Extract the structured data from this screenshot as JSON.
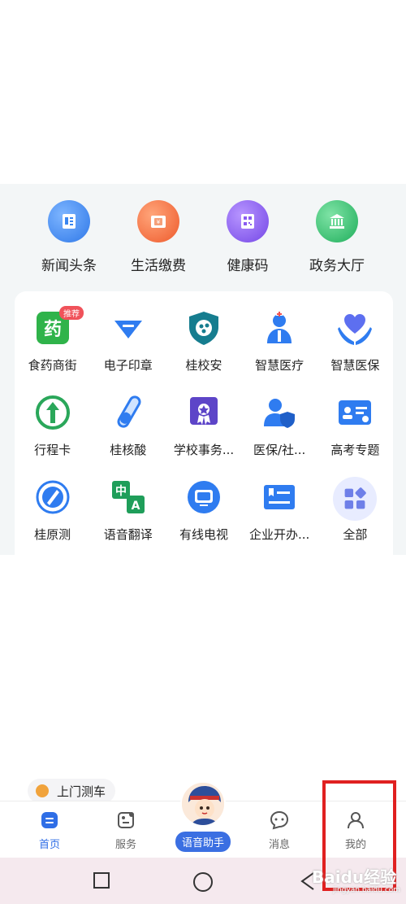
{
  "quick_access": [
    {
      "label": "新闻头条",
      "icon": "news-icon",
      "color": "#3a86f0"
    },
    {
      "label": "生活缴费",
      "icon": "wallet-icon",
      "color": "#f26b3a"
    },
    {
      "label": "健康码",
      "icon": "qrcode-icon",
      "color": "#8a5cf0"
    },
    {
      "label": "政务大厅",
      "icon": "government-building-icon",
      "color": "#2fbf6b"
    }
  ],
  "services": [
    {
      "label": "食药商街",
      "icon": "medicine-icon",
      "badge": "推荐"
    },
    {
      "label": "电子印章",
      "icon": "seal-icon"
    },
    {
      "label": "桂校安",
      "icon": "school-shield-icon"
    },
    {
      "label": "智慧医疗",
      "icon": "doctor-icon"
    },
    {
      "label": "智慧医保",
      "icon": "hands-heart-icon"
    },
    {
      "label": "行程卡",
      "icon": "trip-card-icon"
    },
    {
      "label": "桂核酸",
      "icon": "test-tube-icon"
    },
    {
      "label": "学校事务...",
      "icon": "school-badge-icon"
    },
    {
      "label": "医保/社...",
      "icon": "user-shield-icon"
    },
    {
      "label": "高考专题",
      "icon": "id-card-icon"
    },
    {
      "label": "桂原测",
      "icon": "measure-icon"
    },
    {
      "label": "语音翻译",
      "icon": "translate-icon",
      "glyph_a": "中",
      "glyph_b": "A"
    },
    {
      "label": "有线电视",
      "icon": "tv-icon"
    },
    {
      "label": "企业开办...",
      "icon": "enterprise-icon"
    },
    {
      "label": "全部",
      "icon": "all-apps-icon"
    }
  ],
  "floating_tag": {
    "label": "上门测车",
    "icon": "coin-icon"
  },
  "tabbar": {
    "home": "首页",
    "service": "服务",
    "assistant": "语音助手",
    "messages": "消息",
    "mine": "我的"
  },
  "watermark": {
    "text": "Baidu经验",
    "sub": "jingyan.baidu.com"
  },
  "colors": {
    "primary": "#2f6ee6",
    "highlight_box": "#e02020",
    "panel_bg": "#f3f6f7"
  }
}
